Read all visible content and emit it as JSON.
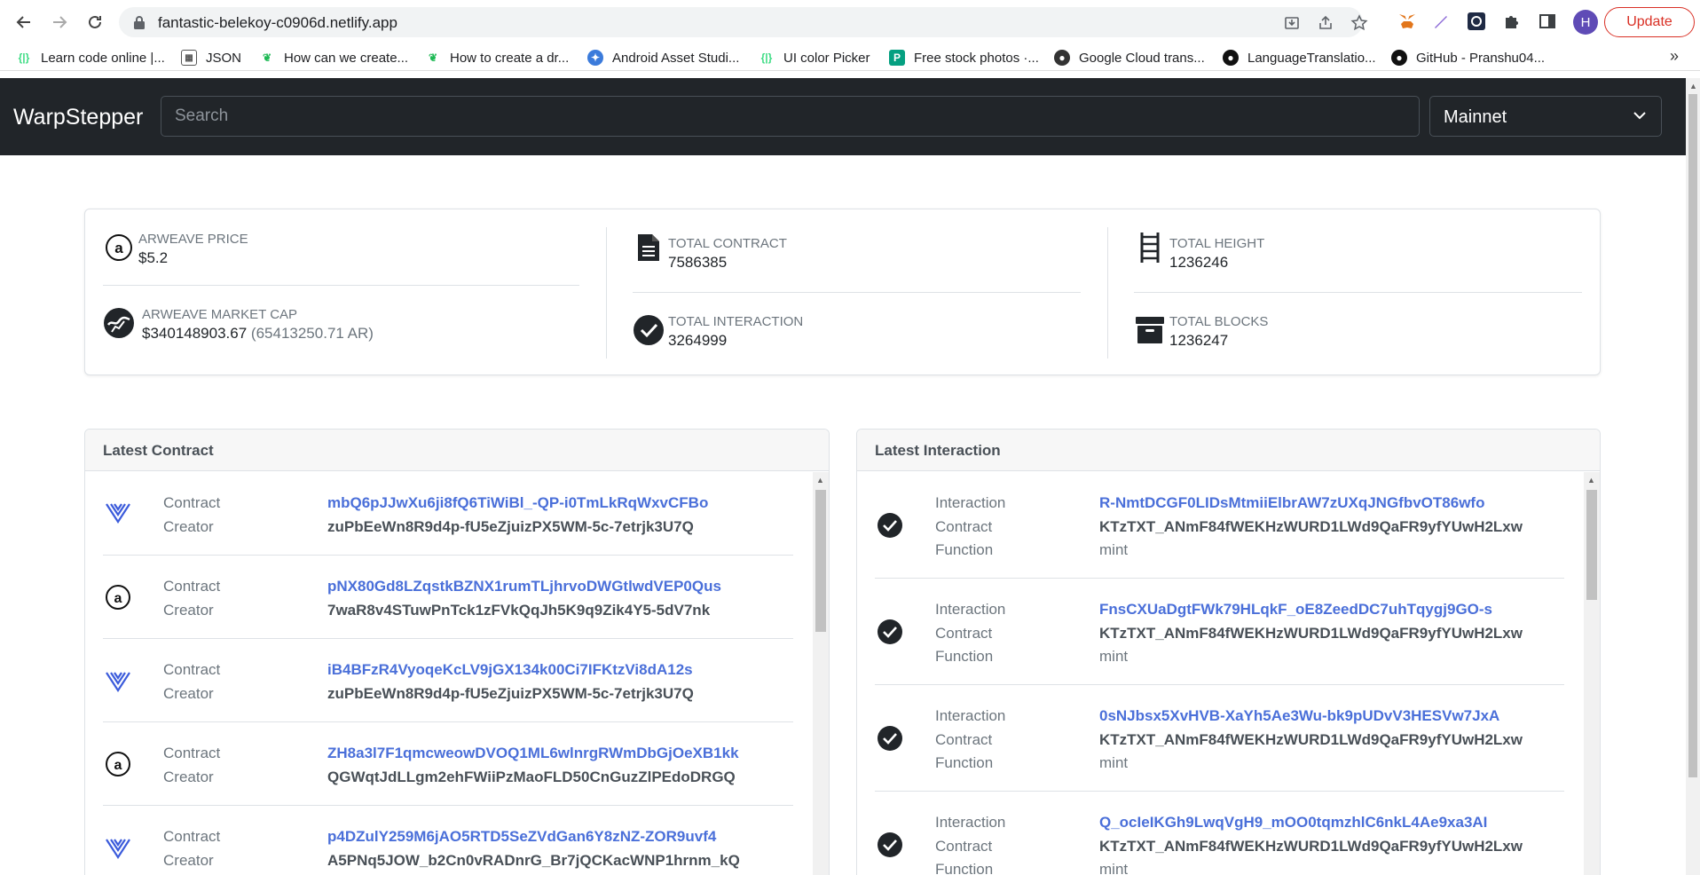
{
  "browser": {
    "url": "fantastic-belekoy-c0906d.netlify.app",
    "avatar_letter": "H",
    "update_label": "Update",
    "bookmarks": [
      {
        "label": "Learn code online |...",
        "icon": "codecademy-icon",
        "color": "#3ddc84"
      },
      {
        "label": "JSON",
        "icon": "json-icon",
        "color": "#555555"
      },
      {
        "label": "How can we create...",
        "icon": "leaf-icon",
        "color": "#1db954"
      },
      {
        "label": "How to create a dr...",
        "icon": "leaf-icon",
        "color": "#1db954"
      },
      {
        "label": "Android Asset Studi...",
        "icon": "asset-studio-icon",
        "color": "#3b7bdb"
      },
      {
        "label": "UI color Picker",
        "icon": "codecademy-icon",
        "color": "#3ddc84"
      },
      {
        "label": "Free stock photos ·...",
        "icon": "photo-icon",
        "color": "#05a081"
      },
      {
        "label": "Google Cloud trans...",
        "icon": "globe-icon",
        "color": "#333333"
      },
      {
        "label": "LanguageTranslatio...",
        "icon": "github-icon",
        "color": "#111111"
      },
      {
        "label": "GitHub - Pranshu04...",
        "icon": "github-icon",
        "color": "#111111"
      }
    ],
    "more_label": "»"
  },
  "navbar": {
    "brand": "WarpStepper",
    "search_placeholder": "Search",
    "network": "Mainnet"
  },
  "stats": {
    "arweave_price": {
      "label": "ARWEAVE PRICE",
      "value": "$5.2"
    },
    "market_cap": {
      "label": "ARWEAVE MARKET CAP",
      "value": "$340148903.67",
      "sub": "(65413250.71 AR)"
    },
    "total_contract": {
      "label": "TOTAL CONTRACT",
      "value": "7586385"
    },
    "total_interaction": {
      "label": "TOTAL INTERACTION",
      "value": "3264999"
    },
    "total_height": {
      "label": "TOTAL HEIGHT",
      "value": "1236246"
    },
    "total_blocks": {
      "label": "TOTAL BLOCKS",
      "value": "1236247"
    }
  },
  "latest_contract": {
    "title": "Latest Contract",
    "key_contract": "Contract",
    "key_creator": "Creator",
    "rows": [
      {
        "icon": "warp-icon",
        "contract": "mbQ6pJJwXu6ji8fQ6TiWiBl_-QP-i0TmLkRqWxvCFBo",
        "creator": "zuPbEeWn8R9d4p-fU5eZjuizPX5WM-5c-7etrjk3U7Q"
      },
      {
        "icon": "arweave-icon",
        "contract": "pNX80Gd8LZqstkBZNX1rumTLjhrvoDWGtlwdVEP0Qus",
        "creator": "7waR8v4STuwPnTck1zFVkQqJh5K9q9Zik4Y5-5dV7nk"
      },
      {
        "icon": "warp-icon",
        "contract": "iB4BFzR4VyoqeKcLV9jGX134k00Ci7IFKtzVi8dA12s",
        "creator": "zuPbEeWn8R9d4p-fU5eZjuizPX5WM-5c-7etrjk3U7Q"
      },
      {
        "icon": "arweave-icon",
        "contract": "ZH8a3l7F1qmcweowDVOQ1ML6wlnrgRWmDbGjOeXB1kk",
        "creator": "QGWqtJdLLgm2ehFWiiPzMaoFLD50CnGuzZlPEdoDRGQ"
      },
      {
        "icon": "warp-icon",
        "contract": "p4DZulY259M6jAO5RTD5SeZVdGan6Y8zNZ-ZOR9uvf4",
        "creator": "A5PNq5JOW_b2Cn0vRADnrG_Br7jQCKacWNP1hrnm_kQ"
      }
    ]
  },
  "latest_interaction": {
    "title": "Latest Interaction",
    "key_interaction": "Interaction",
    "key_contract": "Contract",
    "key_function": "Function",
    "rows": [
      {
        "interaction": "R-NmtDCGF0LIDsMtmiiElbrAW7zUXqJNGfbvOT86wfo",
        "contract": "KTzTXT_ANmF84fWEKHzWURD1LWd9QaFR9yfYUwH2Lxw",
        "function": "mint"
      },
      {
        "interaction": "FnsCXUaDgtFWk79HLqkF_oE8ZeedDC7uhTqygj9GO-s",
        "contract": "KTzTXT_ANmF84fWEKHzWURD1LWd9QaFR9yfYUwH2Lxw",
        "function": "mint"
      },
      {
        "interaction": "0sNJbsx5XvHVB-XaYh5Ae3Wu-bk9pUDvV3HESVw7JxA",
        "contract": "KTzTXT_ANmF84fWEKHzWURD1LWd9QaFR9yfYUwH2Lxw",
        "function": "mint"
      },
      {
        "interaction": "Q_ocIeIKGh9LwqVgH9_mOO0tqmzhlC6nkL4Ae9xa3AI",
        "contract": "KTzTXT_ANmF84fWEKHzWURD1LWd9QaFR9yfYUwH2Lxw",
        "function": "mint"
      }
    ]
  },
  "colors": {
    "navbar_bg": "#212529",
    "link": "#4a6fd9",
    "update_red": "#d93025"
  }
}
